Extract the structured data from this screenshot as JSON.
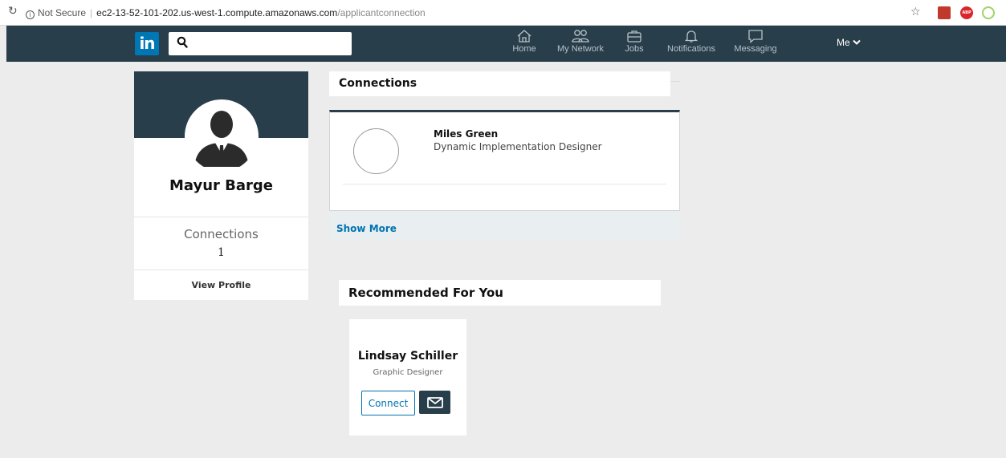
{
  "browser": {
    "security_label": "Not Secure",
    "url_host": "ec2-13-52-101-202.us-west-1.compute.amazonaws.com",
    "url_path": "/applicantconnection",
    "ext_abp_label": "ABP"
  },
  "nav": {
    "logo_text": "in",
    "search_placeholder": "",
    "items": [
      {
        "label": "Home",
        "icon": "home-icon"
      },
      {
        "label": "My Network",
        "icon": "network-icon"
      },
      {
        "label": "Jobs",
        "icon": "briefcase-icon"
      },
      {
        "label": "Notifications",
        "icon": "bell-icon"
      },
      {
        "label": "Messaging",
        "icon": "chat-icon"
      }
    ],
    "me_label": "Me"
  },
  "profile": {
    "name": "Mayur Barge",
    "connections_label": "Connections",
    "connections_count": "1",
    "view_profile_label": "View Profile"
  },
  "connections": {
    "title": "Connections",
    "items": [
      {
        "name": "Miles Green",
        "title": "Dynamic Implementation Designer"
      }
    ],
    "show_more_label": "Show More"
  },
  "recommended": {
    "title": "Recommended For You",
    "people": [
      {
        "name": "Lindsay Schiller",
        "title": "Graphic Designer",
        "connect_label": "Connect"
      }
    ]
  },
  "colors": {
    "navbar": "#283e4a",
    "accent": "#0073b1",
    "logo": "#0077b5",
    "background": "#ececec"
  }
}
